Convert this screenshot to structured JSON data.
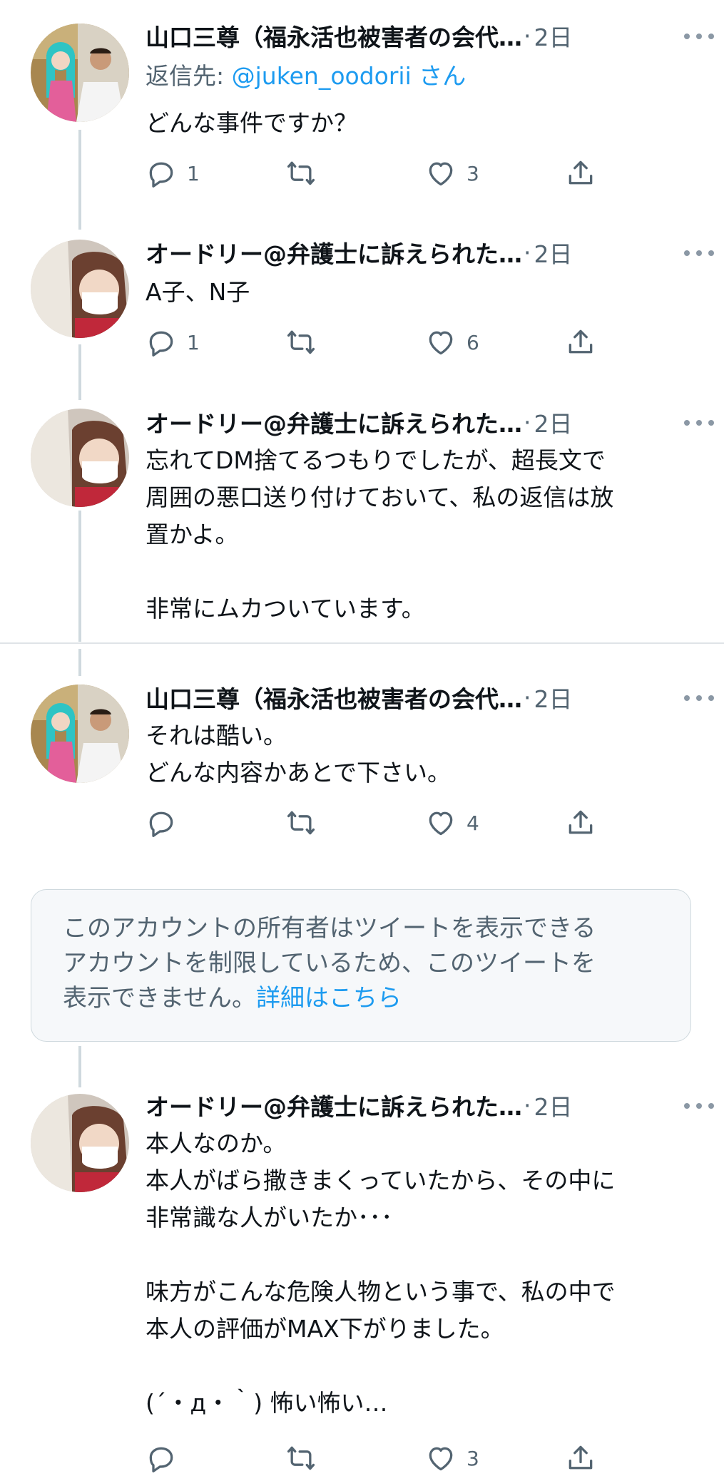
{
  "tweets": [
    {
      "name": "山口三尊（福永活也被害者の会代…",
      "time": "2日",
      "reply_prefix": "返信先: ",
      "reply_handle": "@juken_oodorii",
      "reply_suffix": " さん",
      "text": "どんな事件ですか？",
      "replies": "1",
      "retweets": "",
      "likes": "3"
    },
    {
      "name": "オードリー@弁護士に訴えられた…",
      "time": "2日",
      "text": "A子、N子",
      "replies": "1",
      "retweets": "",
      "likes": "6"
    },
    {
      "name": "オードリー@弁護士に訴えられた…",
      "time": "2日",
      "text": "忘れてDM捨てるつもりでしたが、超長文で\n周囲の悪口送り付けておいて、私の返信は放\n置かよ。\n\n非常にムカついています。"
    },
    {
      "name": "山口三尊（福永活也被害者の会代…",
      "time": "2日",
      "text": "それは酷い。\nどんな内容かあとで下さい。",
      "replies": "",
      "retweets": "",
      "likes": "4"
    },
    {
      "name": "オードリー@弁護士に訴えられた…",
      "time": "2日",
      "text": "本人なのか。\n本人がばら撒きまくっていたから、その中に\n非常識な人がいたか･･･\n\n味方がこんな危険人物という事で、私の中で\n本人の評価がMAX下がりました。\n\n(´・д・｀) 怖い怖い…",
      "likes": "3"
    }
  ],
  "notice": {
    "text": "このアカウントの所有者はツイートを表示できる\nアカウントを制限しているため、このツイートを\n表示できません。",
    "link": "詳細はこちら"
  },
  "separator": "·",
  "colors": {
    "accent": "#1d9bf0",
    "muted": "#536471",
    "line": "#cfd9de"
  },
  "icons": [
    "reply-icon",
    "retweet-icon",
    "like-icon",
    "share-icon",
    "more-icon"
  ]
}
